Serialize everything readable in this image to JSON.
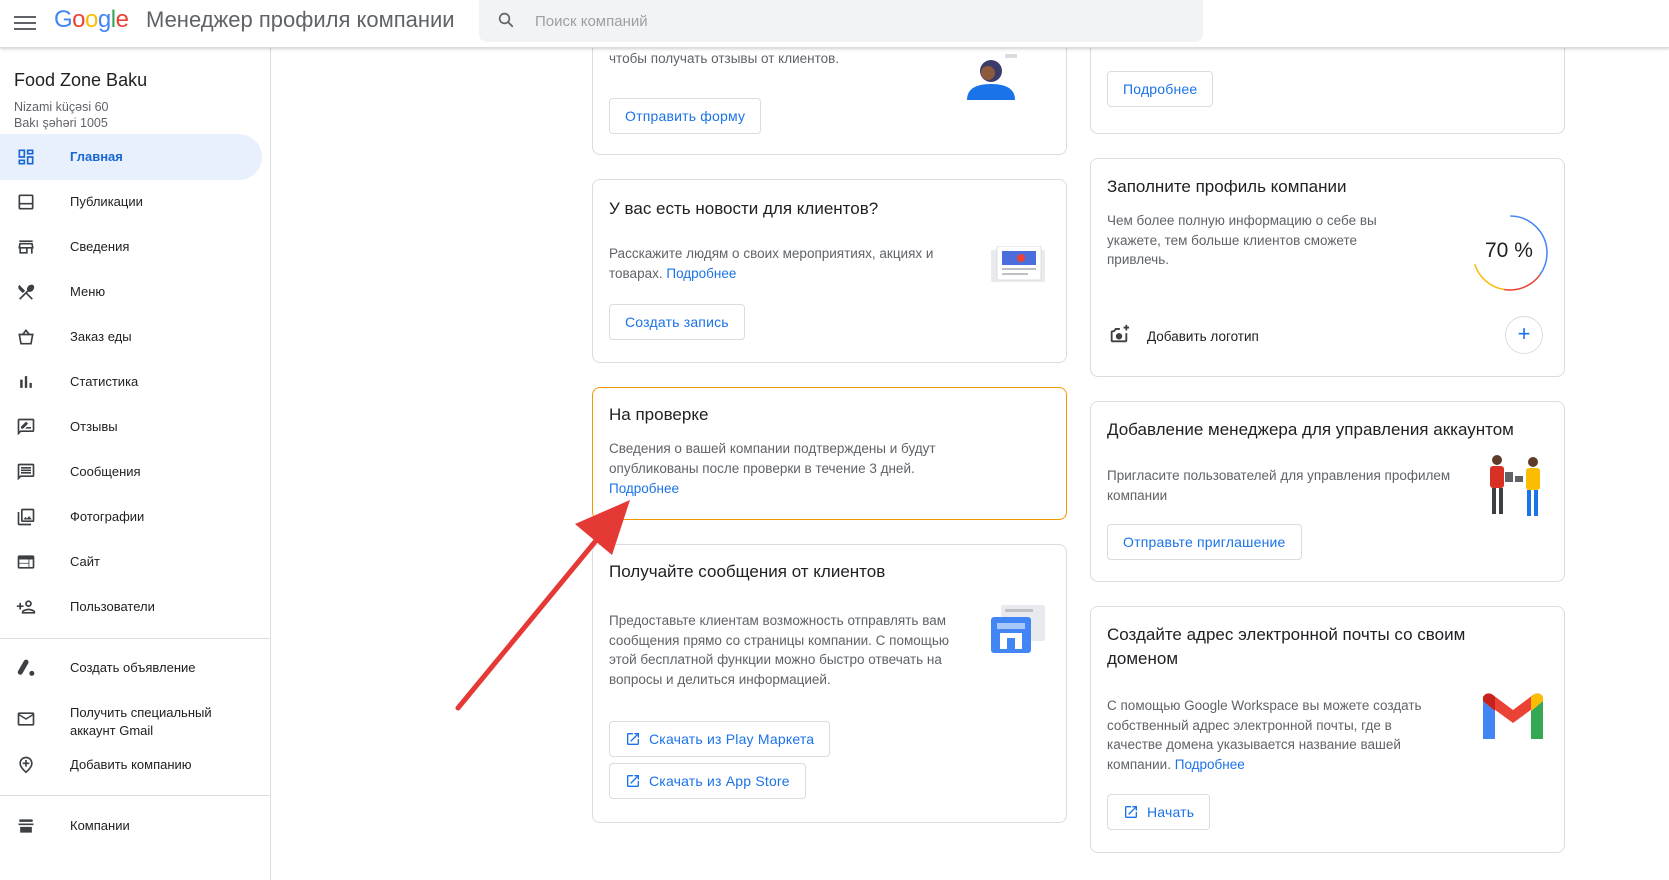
{
  "header": {
    "logo_text": "Google",
    "app_name": "Менеджер профиля компании",
    "search_placeholder": "Поиск компаний"
  },
  "business": {
    "name": "Food Zone Baku",
    "address_line1": "Nizami küçəsi 60",
    "address_line2": "Bakı şəhəri 1005"
  },
  "sidebar": {
    "items": [
      {
        "label": "Главная",
        "icon": "dashboard-icon",
        "active": true
      },
      {
        "label": "Публикации",
        "icon": "posts-icon"
      },
      {
        "label": "Сведения",
        "icon": "storefront-icon"
      },
      {
        "label": "Меню",
        "icon": "restaurant-icon"
      },
      {
        "label": "Заказ еды",
        "icon": "food-order-icon"
      },
      {
        "label": "Статистика",
        "icon": "bar-chart-icon"
      },
      {
        "label": "Отзывы",
        "icon": "rate-review-icon"
      },
      {
        "label": "Сообщения",
        "icon": "message-icon"
      },
      {
        "label": "Фотографии",
        "icon": "photo-library-icon"
      },
      {
        "label": "Сайт",
        "icon": "web-icon"
      },
      {
        "label": "Пользователи",
        "icon": "person-add-icon"
      }
    ],
    "extra": [
      {
        "label": "Создать объявление",
        "icon": "google-ads-icon"
      },
      {
        "label": "Получить специальный аккаунт Gmail",
        "icon": "mail-icon"
      },
      {
        "label": "Добавить компанию",
        "icon": "add-location-icon"
      }
    ],
    "bottom": [
      {
        "label": "Компании",
        "icon": "businesses-icon"
      }
    ]
  },
  "left_column": {
    "review_card": {
      "desc": "чтобы получать отзывы от клиентов.",
      "button": "Отправить форму"
    },
    "news_card": {
      "title": "У вас есть новости для клиентов?",
      "desc": "Расскажите людям о своих мероприятиях, акциях и товарах.",
      "link": "Подробнее",
      "button": "Создать запись"
    },
    "review_status_card": {
      "title": "На проверке",
      "desc": "Сведения о вашей компании подтверждены и будут опубликованы после проверки в течение 3 дней.",
      "link": "Подробнее"
    },
    "messages_card": {
      "title": "Получайте сообщения от клиентов",
      "desc": "Предоставьте клиентам возможность отправлять вам сообщения прямо со страницы компании. С помощью этой бесплатной функции можно быстро отвечать на вопросы и делиться информацией.",
      "button_play": "Скачать из Play Маркета",
      "button_appstore": "Скачать из App Store"
    }
  },
  "right_column": {
    "top_card": {
      "button": "Подробнее"
    },
    "profile_card": {
      "title": "Заполните профиль компании",
      "desc": "Чем более полную информацию о себе вы укажете, тем больше клиентов сможете привлечь.",
      "percent_label": "70 %",
      "percent": 70,
      "action_label": "Добавить логотип",
      "add_button": "+"
    },
    "manager_card": {
      "title": "Добавление менеджера для управления аккаунтом",
      "desc": "Пригласите пользователей для управления профилем компании",
      "button": "Отправьте приглашение"
    },
    "email_card": {
      "title": "Создайте адрес электронной почты со своим доменом",
      "desc": "С помощью Google Workspace вы можете создать собственный адрес электронной почты, где в качестве домена указывается название вашей компании.",
      "link": "Подробнее",
      "button": "Начать"
    }
  },
  "colors": {
    "accent": "#1a73e8",
    "active_bg": "#e8f0fe",
    "warning_border": "#f29900",
    "arrow": "#e53935"
  }
}
